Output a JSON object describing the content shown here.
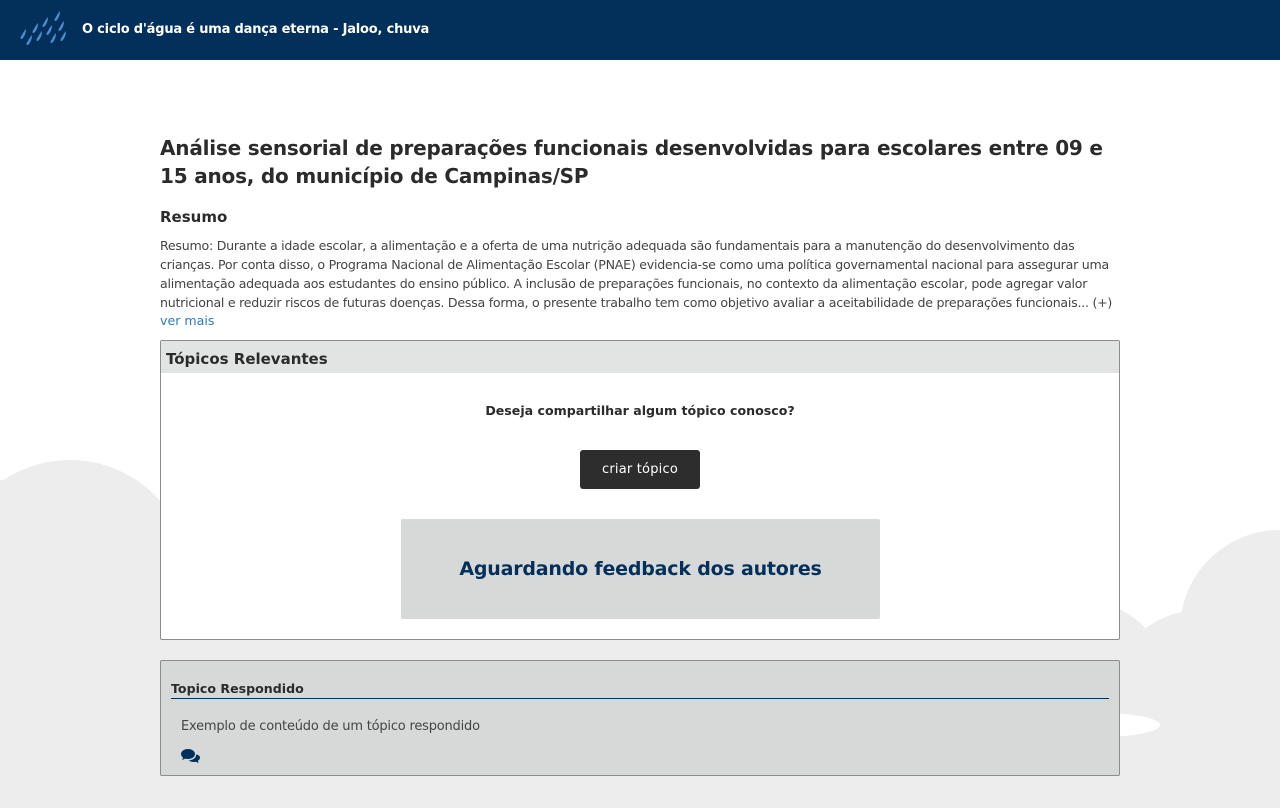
{
  "header": {
    "title": "O ciclo d'água é uma dança eterna - Jaloo, chuva",
    "logo_icon": "rain-drops-icon",
    "background_color": "#03305a"
  },
  "article": {
    "title": "Análise sensorial de preparações funcionais desenvolvidas para escolares entre 09 e 15 anos, do município de Campinas/SP",
    "abstract_heading": "Resumo",
    "abstract_text": "Resumo: Durante a idade escolar, a alimentação e a oferta de uma nutrição adequada são fundamentais para a manutenção do desenvolvimento das crianças. Por conta disso, o Programa Nacional de Alimentação Escolar (PNAE) evidencia-se como uma política governamental nacional para assegurar uma alimentação adequada aos estudantes do ensino público. A inclusão de preparações funcionais, no contexto da alimentação escolar, pode agregar valor nutricional e reduzir riscos de futuras doenças. Dessa forma, o presente trabalho tem como objetivo avaliar a aceitabilidade de preparações funcionais... (+)",
    "see_more_label": "ver mais",
    "link_color": "#2a7bc4"
  },
  "topics": {
    "header": "Tópicos Relevantes",
    "question": "Deseja compartilhar algum tópico conosco?",
    "create_button_label": "criar tópico",
    "feedback_status": "Aguardando feedback dos autores",
    "accent_color": "#03305a"
  },
  "answered_topic": {
    "title": "Topico Respondido",
    "content": "Exemplo de conteúdo de um tópico respondido",
    "icon": "comments-icon"
  }
}
